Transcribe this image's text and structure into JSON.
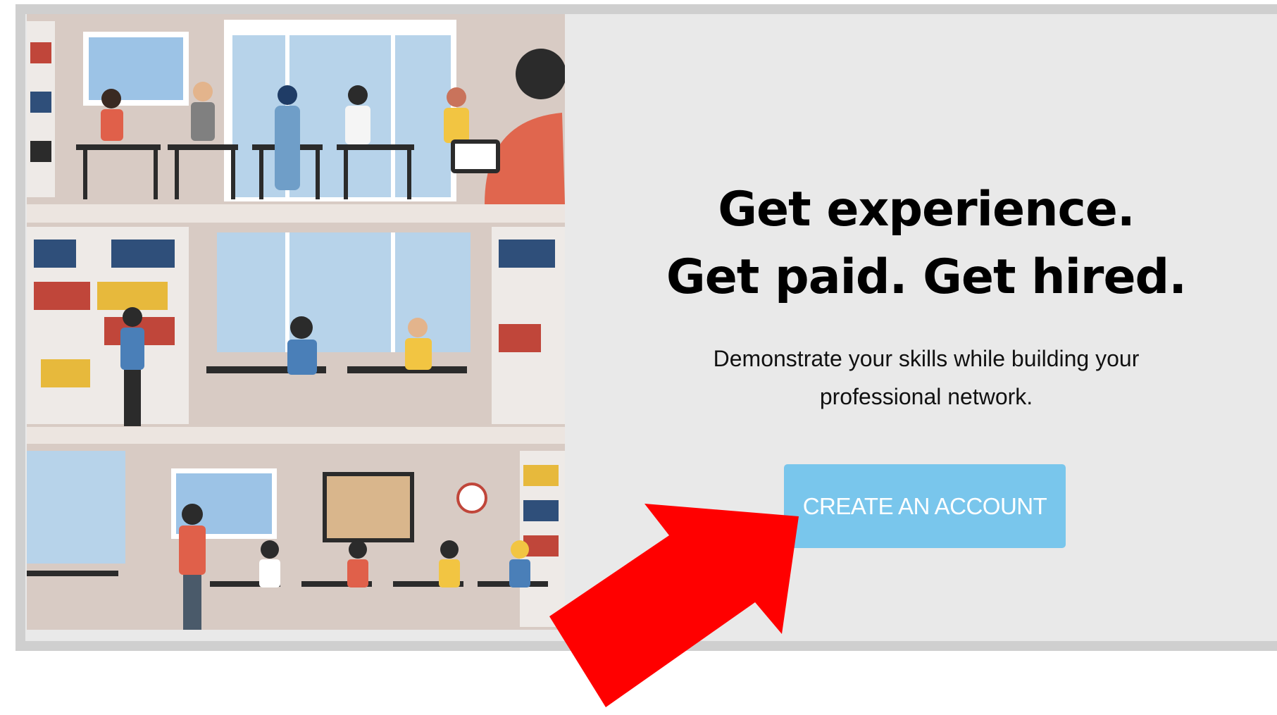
{
  "hero": {
    "headline_line1": "Get experience.",
    "headline_line2": "Get paid. Get hired.",
    "subtext": "Demonstrate your skills while building your professional network."
  },
  "cta": {
    "label": "CREATE AN ACCOUNT"
  },
  "colors": {
    "background": "#e9e9e9",
    "frame": "#cfcfcf",
    "button": "#79c6ec",
    "arrow": "#ff0000",
    "wall": "#d6c8c2"
  },
  "icons": {
    "annotation": "red-arrow-icon"
  }
}
